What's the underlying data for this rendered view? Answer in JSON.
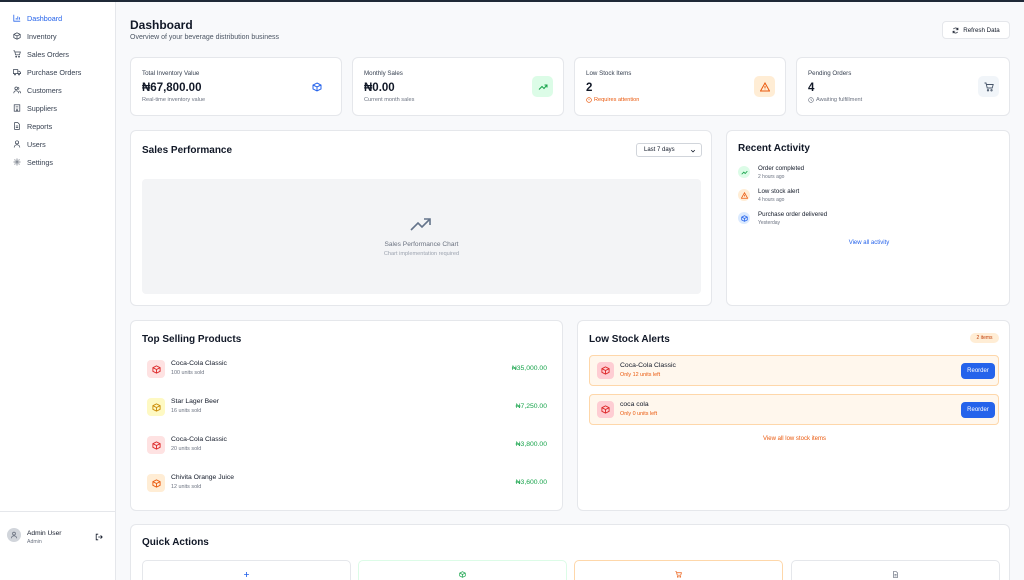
{
  "sidebar": {
    "items": [
      {
        "label": "Dashboard",
        "icon": "bar-chart-icon",
        "active": true
      },
      {
        "label": "Inventory",
        "icon": "box-icon"
      },
      {
        "label": "Sales Orders",
        "icon": "cart-icon"
      },
      {
        "label": "Purchase Orders",
        "icon": "truck-icon"
      },
      {
        "label": "Customers",
        "icon": "users-icon"
      },
      {
        "label": "Suppliers",
        "icon": "building-icon"
      },
      {
        "label": "Reports",
        "icon": "file-icon"
      },
      {
        "label": "Users",
        "icon": "user-icon"
      },
      {
        "label": "Settings",
        "icon": "gear-icon"
      }
    ],
    "user": {
      "name": "Admin User",
      "role": "Admin"
    }
  },
  "header": {
    "title": "Dashboard",
    "subtitle": "Overview of your beverage distribution business",
    "refresh_label": "Refresh Data"
  },
  "stats": [
    {
      "label": "Total Inventory Value",
      "value": "₦67,800.00",
      "sub": "Real-time inventory value",
      "icon": "box-icon",
      "color": "#2563eb"
    },
    {
      "label": "Monthly Sales",
      "value": "₦0.00",
      "sub": "Current month sales",
      "icon": "trending-up-icon",
      "color": "#16a34a"
    },
    {
      "label": "Low Stock Items",
      "value": "2",
      "sub": "Requires attention",
      "icon": "warning-icon",
      "color": "#ea580c"
    },
    {
      "label": "Pending Orders",
      "value": "4",
      "sub": "Awaiting fulfillment",
      "icon": "cart-icon",
      "color": "#475569"
    }
  ],
  "sales_performance": {
    "title": "Sales Performance",
    "range": "Last 7 days",
    "placeholder_title": "Sales Performance Chart",
    "placeholder_sub": "Chart implementation required"
  },
  "recent_activity": {
    "title": "Recent Activity",
    "items": [
      {
        "text": "Order completed",
        "time": "2 hours ago",
        "icon": "trending-up-icon",
        "color": "#16a34a"
      },
      {
        "text": "Low stock alert",
        "time": "4 hours ago",
        "icon": "warning-icon",
        "color": "#ea580c"
      },
      {
        "text": "Purchase order delivered",
        "time": "Yesterday",
        "icon": "box-icon",
        "color": "#2563eb"
      }
    ],
    "view_all": "View all activity"
  },
  "top_products": {
    "title": "Top Selling Products",
    "items": [
      {
        "name": "Coca-Cola Classic",
        "sold": "100 units sold",
        "amount": "₦35,000.00",
        "color": "#dc2626"
      },
      {
        "name": "Star Lager Beer",
        "sold": "16 units sold",
        "amount": "₦7,250.00",
        "color": "#ca8a04"
      },
      {
        "name": "Coca-Cola Classic",
        "sold": "20 units sold",
        "amount": "₦3,800.00",
        "color": "#dc2626"
      },
      {
        "name": "Chivita Orange Juice",
        "sold": "12 units sold",
        "amount": "₦3,600.00",
        "color": "#ea580c"
      }
    ]
  },
  "low_stock": {
    "title": "Low Stock Alerts",
    "badge": "2 items",
    "items": [
      {
        "name": "Coca-Cola Classic",
        "sub": "Only 12 units left"
      },
      {
        "name": "coca cola",
        "sub": "Only 0 units left"
      }
    ],
    "reorder_label": "Reorder",
    "view_all": "View all low stock items"
  },
  "quick_actions": {
    "title": "Quick Actions",
    "items": [
      {
        "icon": "plus-icon",
        "color": "#2563eb"
      },
      {
        "icon": "box-icon",
        "color": "#16a34a"
      },
      {
        "icon": "cart-icon",
        "color": "#ea580c"
      },
      {
        "icon": "file-icon",
        "color": "#6b7280"
      }
    ]
  }
}
